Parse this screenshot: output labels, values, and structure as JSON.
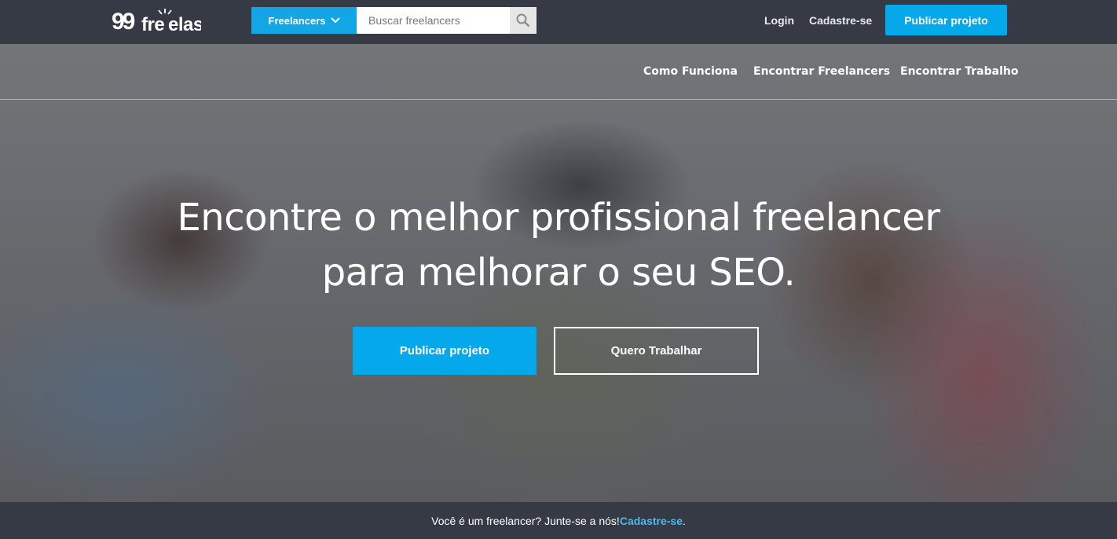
{
  "header": {
    "logo_text": "99freelas",
    "category_label": "Freelancers",
    "search_placeholder": "Buscar freelancers",
    "login_label": "Login",
    "signup_label": "Cadastre-se",
    "publish_label": "Publicar projeto"
  },
  "hero": {
    "nav": [
      "Como Funciona",
      "Encontrar Freelancers",
      "Encontrar Trabalho"
    ],
    "title_line1": "Encontre o melhor profissional freelancer",
    "title_line2": "para melhorar o seu SEO.",
    "primary_button": "Publicar projeto",
    "secondary_button": "Quero Trabalhar"
  },
  "footer": {
    "prompt": "Você é um freelancer? Junte-se a nós! ",
    "link": "Cadastre-se",
    "suffix": "."
  },
  "colors": {
    "bar_bg": "#363a45",
    "accent": "#06a8ec",
    "footer_link": "#4ab9ee"
  }
}
